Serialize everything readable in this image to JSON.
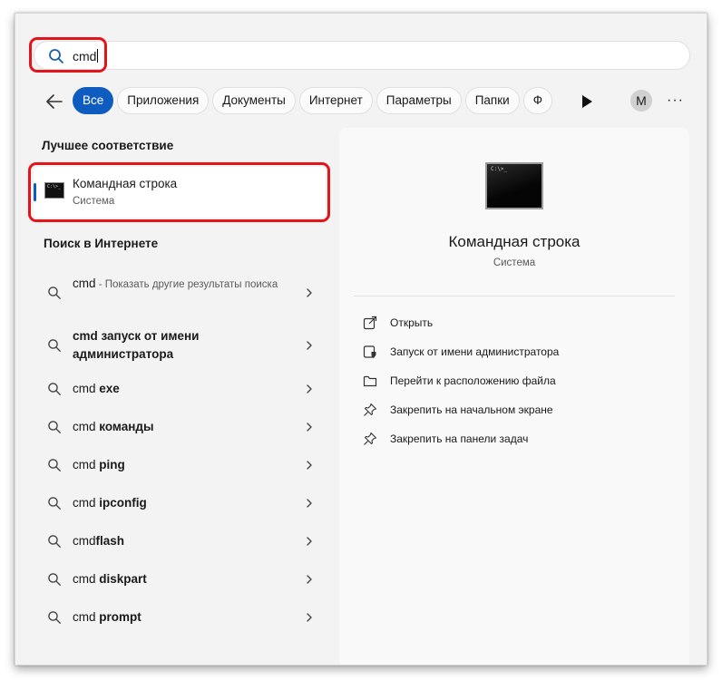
{
  "search": {
    "query": "cmd"
  },
  "filters": {
    "items": [
      "Все",
      "Приложения",
      "Документы",
      "Интернет",
      "Параметры",
      "Папки",
      "Ф"
    ],
    "active_index": 0
  },
  "account": {
    "avatar_letter": "M"
  },
  "more_label": "···",
  "best_match": {
    "section_title": "Лучшее соответствие",
    "title": "Командная строка",
    "subtitle": "Система",
    "icon": "cmd-icon"
  },
  "web": {
    "section_title": "Поиск в Интернете",
    "results": [
      {
        "term": "cmd",
        "suffix": " - Показать другие результаты поиска"
      },
      {
        "bold": "cmd запуск от имени администратора"
      },
      {
        "term": "cmd ",
        "bold": "exe"
      },
      {
        "term": "cmd ",
        "bold": "команды"
      },
      {
        "term": "cmd ",
        "bold": "ping"
      },
      {
        "term": "cmd ",
        "bold": "ipconfig"
      },
      {
        "term": "cmd",
        "bold": "flash"
      },
      {
        "term": "cmd ",
        "bold": "diskpart"
      },
      {
        "term": "cmd ",
        "bold": "prompt"
      }
    ]
  },
  "preview": {
    "title": "Командная строка",
    "subtitle": "Система",
    "icon_text": "C:\\>_",
    "actions": [
      {
        "label": "Открыть",
        "icon": "open-icon"
      },
      {
        "label": "Запуск от имени администратора",
        "icon": "shield-icon"
      },
      {
        "label": "Перейти к расположению файла",
        "icon": "folder-icon"
      },
      {
        "label": "Закрепить на начальном экране",
        "icon": "pin-icon"
      },
      {
        "label": "Закрепить на панели задач",
        "icon": "pin-icon"
      }
    ]
  },
  "colors": {
    "accent": "#0f5cc0",
    "highlight": "#e3141a"
  }
}
